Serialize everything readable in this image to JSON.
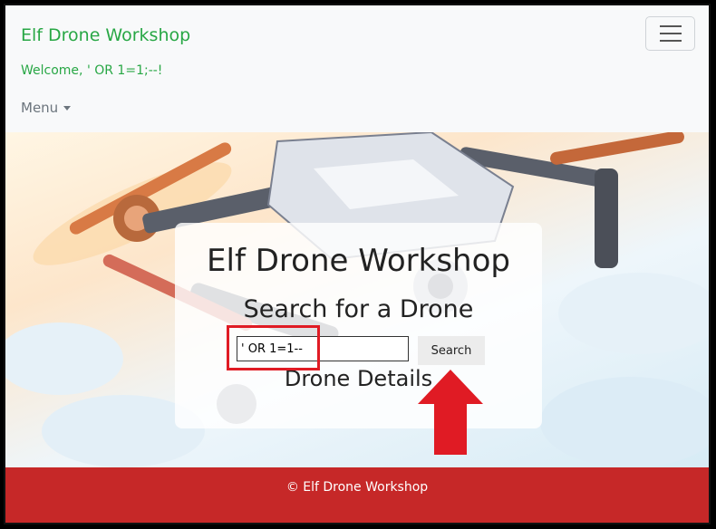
{
  "navbar": {
    "brand": "Elf Drone Workshop",
    "welcome": "Welcome, ' OR 1=1;--!",
    "menu_label": "Menu"
  },
  "hero": {
    "title": "Elf Drone Workshop",
    "subtitle": "Search for a Drone",
    "search": {
      "value": "' OR 1=1--",
      "button_label": "Search"
    },
    "details_heading": "Drone Details"
  },
  "footer": {
    "text": "© Elf Drone Workshop"
  },
  "colors": {
    "brand": "#28a745",
    "footer": "#c62828",
    "annotation": "#e01b24"
  }
}
